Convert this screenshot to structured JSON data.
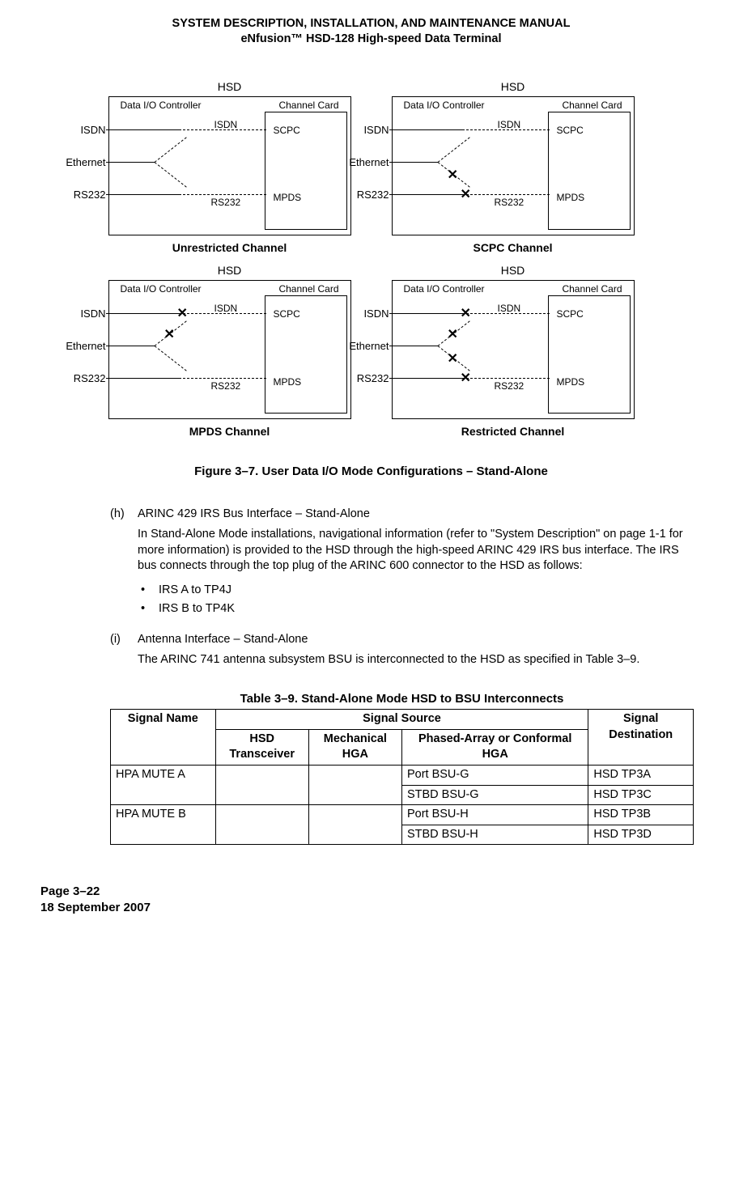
{
  "header": {
    "line1": "SYSTEM DESCRIPTION, INSTALLATION, AND MAINTENANCE MANUAL",
    "line2": "eNfusion™ HSD-128 High-speed Data Terminal"
  },
  "diagrams": {
    "hsd": "HSD",
    "io_ctrl": "Data I/O Controller",
    "chan_card": "Channel Card",
    "isdn_out": "ISDN",
    "eth_out": "Ethernet",
    "rs232_out": "RS232",
    "isdn_mid": "ISDN",
    "rs232_mid": "RS232",
    "scpc": "SCPC",
    "mpds": "MPDS",
    "cap_ul": "Unrestricted Channel",
    "cap_ur": "SCPC  Channel",
    "cap_ll": "MPDS  Channel",
    "cap_lr": "Restricted Channel"
  },
  "figure_caption": "Figure 3–7. User Data I/O Mode Configurations – Stand-Alone",
  "item_h": {
    "mark": "(h)",
    "title": "ARINC 429 IRS Bus Interface – Stand-Alone",
    "para": "In Stand-Alone Mode installations, navigational information (refer to \"System Description\" on page 1-1 for more information) is provided to the HSD through the high-speed ARINC 429 IRS bus interface. The IRS bus connects through the top plug of the ARINC 600 connector to the HSD as follows:",
    "bullets": [
      "IRS A to TP4J",
      "IRS B to TP4K"
    ]
  },
  "item_i": {
    "mark": "(i)",
    "title": "Antenna Interface – Stand-Alone",
    "para": "The ARINC 741 antenna subsystem BSU is interconnected to the HSD as specified in Table 3–9."
  },
  "table": {
    "caption": "Table 3–9. Stand-Alone Mode HSD to BSU Interconnects",
    "h_signal_name": "Signal Name",
    "h_signal_source": "Signal Source",
    "h_signal_dest": "Signal Destination",
    "h_hsd_trans": "HSD Transceiver",
    "h_mech_hga": "Mechanical HGA",
    "h_phased": "Phased-Array or Conformal HGA",
    "rows": [
      {
        "name": "HPA MUTE A",
        "phased": "Port BSU-G",
        "dest": "HSD TP3A"
      },
      {
        "name": "",
        "phased": "STBD BSU-G",
        "dest": "HSD TP3C"
      },
      {
        "name": "HPA MUTE B",
        "phased": "Port BSU-H",
        "dest": "HSD TP3B"
      },
      {
        "name": "",
        "phased": "STBD BSU-H",
        "dest": "HSD TP3D"
      }
    ]
  },
  "footer": {
    "page": "Page 3–22",
    "date": "18 September 2007"
  }
}
